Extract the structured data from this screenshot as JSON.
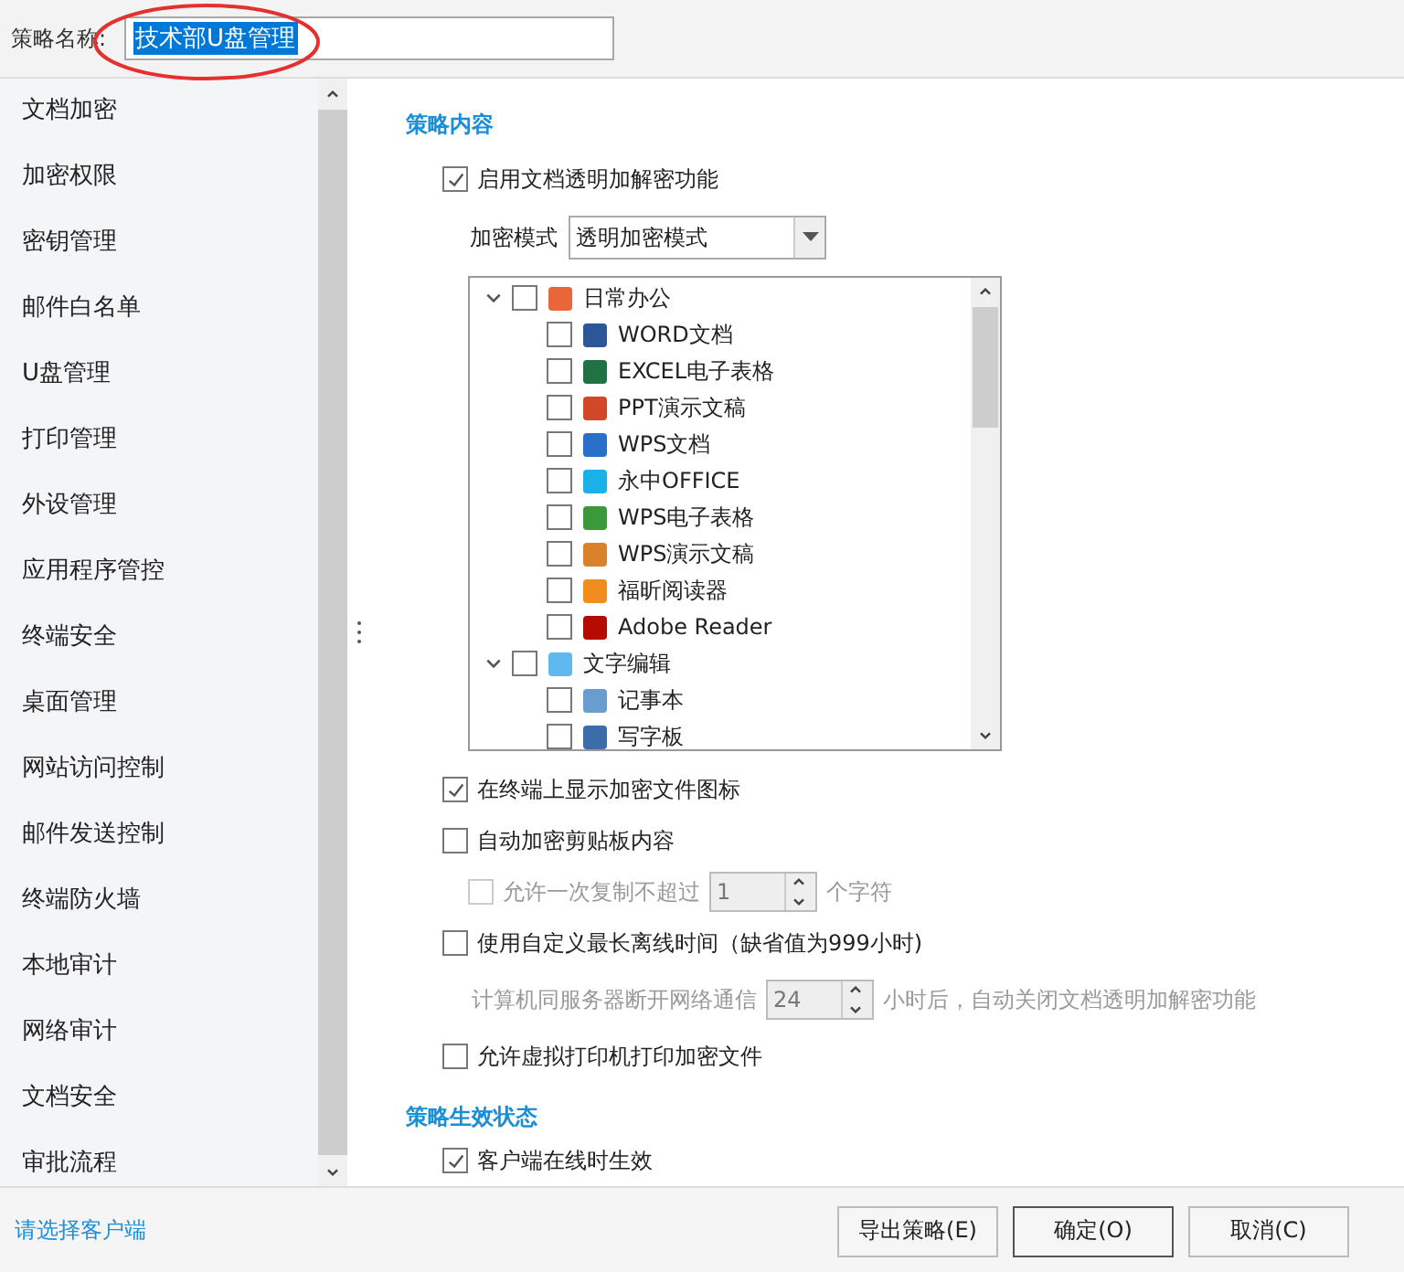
{
  "name_field": {
    "label": "策略名称:",
    "value": "技术部U盘管理",
    "annotated": true
  },
  "sidebar": {
    "items": [
      "文档加密",
      "加密权限",
      "密钥管理",
      "邮件白名单",
      "U盘管理",
      "打印管理",
      "外设管理",
      "应用程序管控",
      "终端安全",
      "桌面管理",
      "网站访问控制",
      "邮件发送控制",
      "终端防火墙",
      "本地审计",
      "网络审计",
      "文档安全",
      "审批流程"
    ]
  },
  "content": {
    "heading": "策略内容",
    "enable": {
      "label": "启用文档透明加解密功能",
      "checked": true
    },
    "mode": {
      "label": "加密模式",
      "value": "透明加密模式"
    },
    "tree": [
      {
        "label": "日常办公",
        "expanded": true,
        "checked": false,
        "color": "#e8663a",
        "children": [
          {
            "label": "WORD文档",
            "checked": false,
            "color": "#2b5797"
          },
          {
            "label": "EXCEL电子表格",
            "checked": false,
            "color": "#207245"
          },
          {
            "label": "PPT演示文稿",
            "checked": false,
            "color": "#d24726"
          },
          {
            "label": "WPS文档",
            "checked": false,
            "color": "#2a6fc9"
          },
          {
            "label": "永中OFFICE",
            "checked": false,
            "color": "#1ab0e8"
          },
          {
            "label": "WPS电子表格",
            "checked": false,
            "color": "#3a9a3a"
          },
          {
            "label": "WPS演示文稿",
            "checked": false,
            "color": "#d9822b"
          },
          {
            "label": "福昕阅读器",
            "checked": false,
            "color": "#f28c1e"
          },
          {
            "label": "Adobe Reader",
            "checked": false,
            "color": "#b30b00"
          }
        ]
      },
      {
        "label": "文字编辑",
        "expanded": true,
        "checked": false,
        "color": "#5fb8f0",
        "children": [
          {
            "label": "记事本",
            "checked": false,
            "color": "#6a9ccf"
          },
          {
            "label": "写字板",
            "checked": false,
            "color": "#3b6ea8"
          }
        ]
      }
    ],
    "options": [
      {
        "kind": "check",
        "label": "在终端上显示加密文件图标",
        "checked": true,
        "disabled": false
      },
      {
        "kind": "check",
        "label": "自动加密剪贴板内容",
        "checked": false,
        "disabled": false
      },
      {
        "kind": "spin-check",
        "label": "允许一次复制不超过",
        "value": "1",
        "suffix": "个字符",
        "checked": false,
        "disabled": true
      },
      {
        "kind": "check",
        "label": "使用自定义最长离线时间（缺省值为999小时)",
        "checked": false,
        "disabled": false
      },
      {
        "kind": "spin",
        "label": "计算机同服务器断开网络通信",
        "value": "24",
        "suffix": "小时后，自动关闭文档透明加解密功能",
        "disabled": true
      },
      {
        "kind": "check",
        "label": "允许虚拟打印机打印加密文件",
        "checked": false,
        "disabled": false
      }
    ],
    "heading2": "策略生效状态",
    "options2": [
      {
        "label": "客户端在线时生效",
        "checked": true
      }
    ]
  },
  "footer": {
    "link": "请选择客户端",
    "buttons": [
      {
        "label": "导出策略(E)",
        "default": false
      },
      {
        "label": "确定(O)",
        "default": true
      },
      {
        "label": "取消(C)",
        "default": false
      }
    ]
  }
}
